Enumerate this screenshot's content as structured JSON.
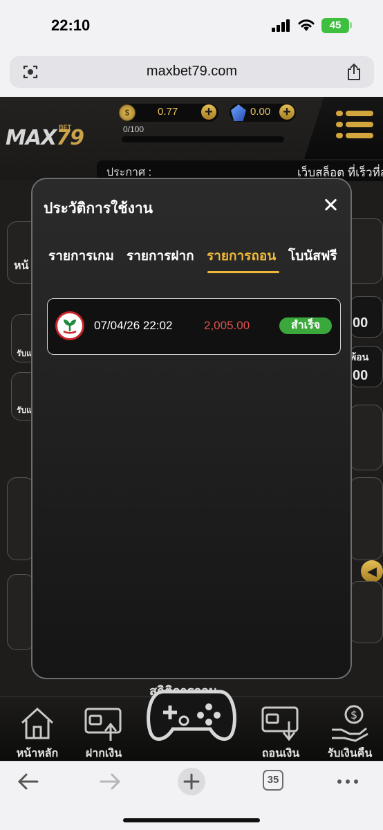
{
  "status_bar": {
    "time": "22:10",
    "battery": "45"
  },
  "browser": {
    "url": "maxbet79.com",
    "tabs_count": "35"
  },
  "site_header": {
    "logo_text": "MAX",
    "logo_number": "79",
    "logo_small": "BET",
    "coin_balance": "0.77",
    "gem_balance": "0.00",
    "level_progress": "0/100",
    "announcement_label": "ประกาศ :",
    "announcement_text": "เว็บสล็อต ที่เร็วที่สุ"
  },
  "background_fragments": {
    "left_a": "หน้",
    "left_b": "รับแ",
    "left_c": "รับแ",
    "right_a": "00",
    "right_b": "พ้อน",
    "right_c": "00",
    "caption": "สถิติการถอน"
  },
  "modal": {
    "title": "ประวัติการใช้งาน",
    "tabs": [
      {
        "label": "รายการเกม",
        "active": false
      },
      {
        "label": "รายการฝาก",
        "active": false
      },
      {
        "label": "รายการถอน",
        "active": true
      },
      {
        "label": "โบนัสฟรี",
        "active": false
      }
    ],
    "transactions": [
      {
        "bank_icon": "kasikorn-bank-icon",
        "datetime": "07/04/26 22:02",
        "amount": "2,005.00",
        "status": "สำเร็จ"
      }
    ]
  },
  "bottom_nav": [
    {
      "label": "หน้าหลัก",
      "icon": "home-icon"
    },
    {
      "label": "ฝากเงิน",
      "icon": "deposit-icon"
    },
    {
      "label": "",
      "icon": "gamepad-icon"
    },
    {
      "label": "ถอนเงิน",
      "icon": "withdraw-icon"
    },
    {
      "label": "รับเงินคืน",
      "icon": "cashback-icon"
    }
  ],
  "colors": {
    "accent_gold": "#f0b83a",
    "success": "#3aa83a",
    "amount_red": "#e0504e"
  }
}
